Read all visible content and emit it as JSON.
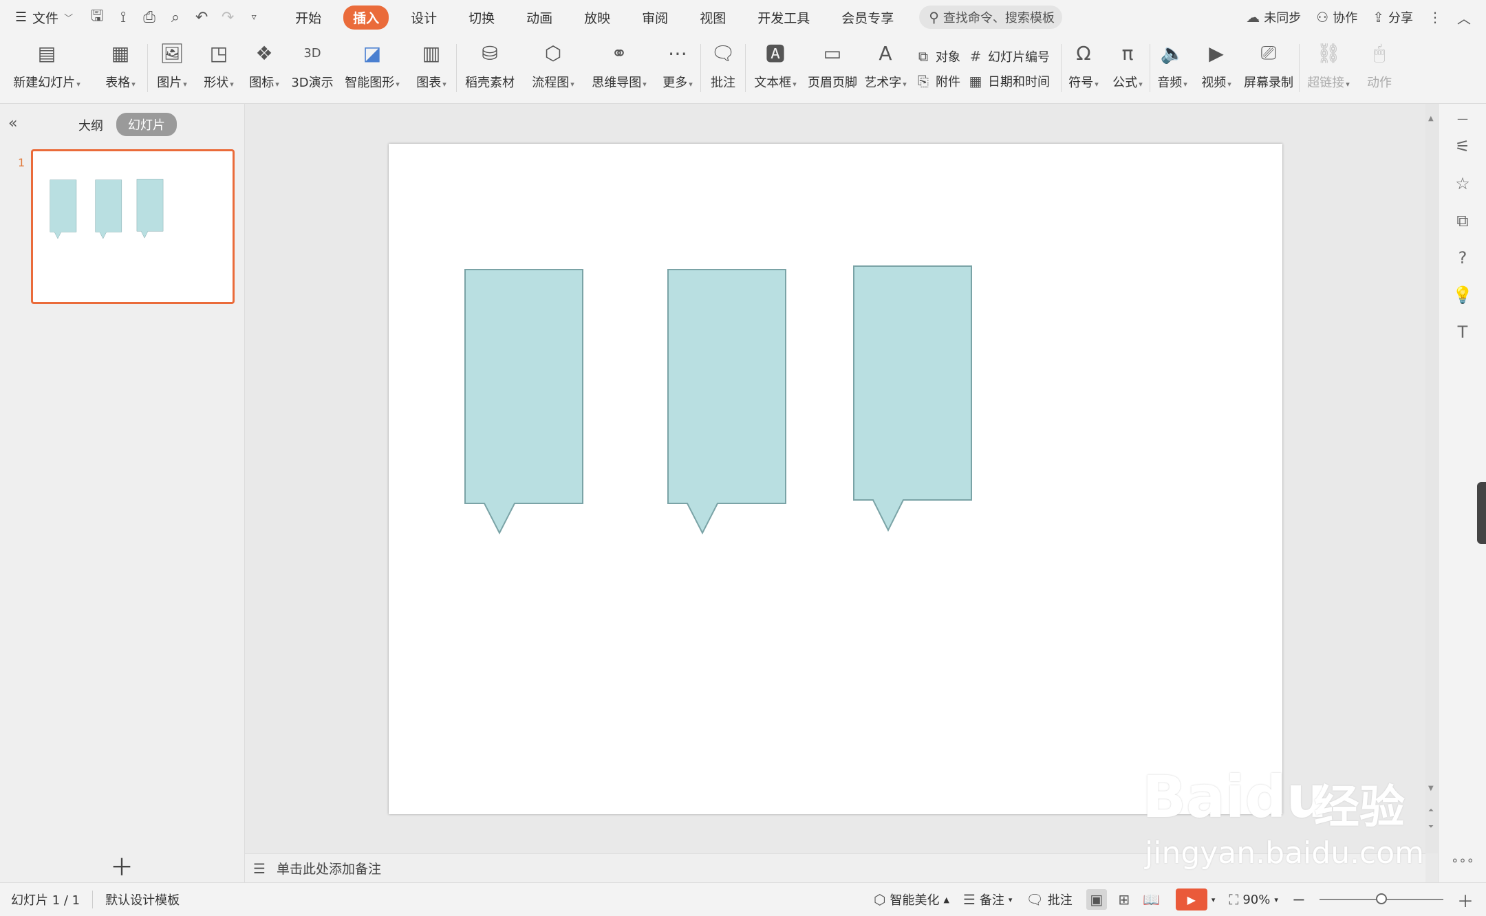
{
  "app": {
    "file_menu_label": "文件",
    "tabs": [
      "开始",
      "插入",
      "设计",
      "切换",
      "动画",
      "放映",
      "审阅",
      "视图",
      "开发工具",
      "会员专享"
    ],
    "active_tab": "插入",
    "search_placeholder": "查找命令、搜索模板",
    "sync_label": "未同步",
    "collab_label": "协作",
    "share_label": "分享"
  },
  "ribbon": {
    "new_slide": "新建幻灯片",
    "table": "表格",
    "picture": "图片",
    "shape": "形状",
    "icon": "图标",
    "demo3d": "3D演示",
    "smartart": "智能图形",
    "chart": "图表",
    "material": "稻壳素材",
    "flowchart": "流程图",
    "mindmap": "思维导图",
    "more": "更多",
    "comment": "批注",
    "textbox": "文本框",
    "header_footer": "页眉页脚",
    "wordart": "艺术字",
    "object": "对象",
    "slide_number": "幻灯片编号",
    "attachment": "附件",
    "datetime": "日期和时间",
    "symbol": "符号",
    "formula": "公式",
    "audio": "音频",
    "video": "视频",
    "screen_record": "屏幕录制",
    "hyperlink": "超链接",
    "action": "动作"
  },
  "left_panel": {
    "outline_tab": "大纲",
    "slides_tab": "幻灯片",
    "slide_number": "1"
  },
  "slide": {
    "shapes": [
      {
        "type": "rectangular-callout",
        "fill": "#b9dfe1",
        "stroke": "#7aa3a6"
      },
      {
        "type": "rectangular-callout",
        "fill": "#b9dfe1",
        "stroke": "#7aa3a6"
      },
      {
        "type": "rectangular-callout",
        "fill": "#b9dfe1",
        "stroke": "#7aa3a6"
      }
    ]
  },
  "notes": {
    "placeholder": "单击此处添加备注"
  },
  "status": {
    "slide_indicator": "幻灯片 1 / 1",
    "template": "默认设计模板",
    "beautify": "智能美化",
    "notes": "备注",
    "comments": "批注",
    "zoom": "90%",
    "zoom_level": 0.5
  },
  "watermark": {
    "brand": "Baidu",
    "brand_cn": "经验",
    "url": "jingyan.baidu.com"
  },
  "colors": {
    "accent": "#ea6b3a",
    "play": "#ea5a3a",
    "shape_fill": "#b9dfe1",
    "shape_stroke": "#7aa3a6"
  }
}
